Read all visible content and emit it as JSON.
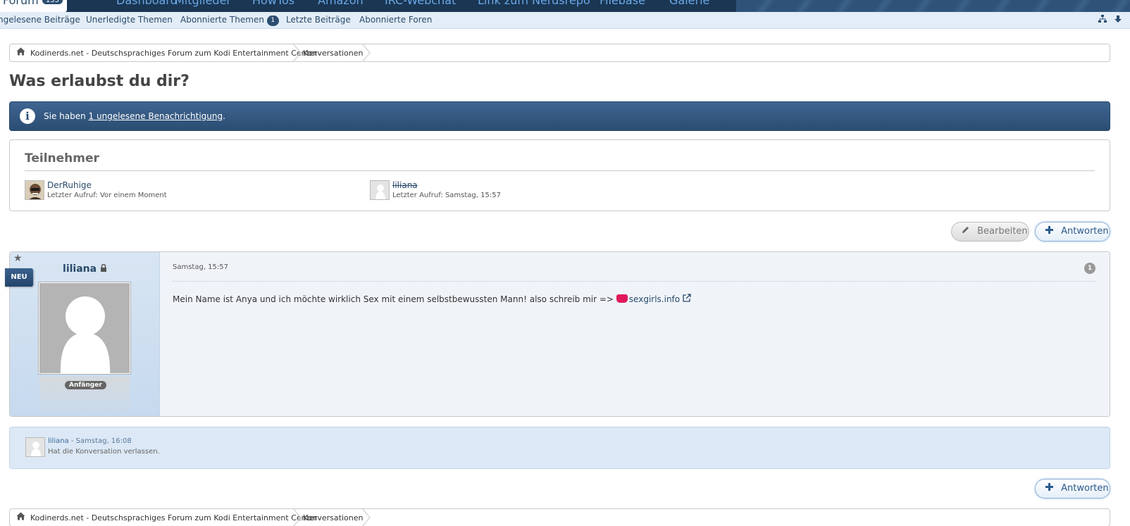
{
  "top_nav": {
    "tabs": [
      {
        "label": "Forum",
        "badge": "153"
      },
      {
        "label": "Dashboard"
      },
      {
        "label": "Mitglieder"
      },
      {
        "label": "HowTos"
      },
      {
        "label": "Amazon"
      },
      {
        "label": "IRC-Webchat"
      },
      {
        "label": "Link zum Nerdsrepo"
      },
      {
        "label": "Filebase"
      },
      {
        "label": "Galerie"
      }
    ]
  },
  "sub_nav": {
    "items": [
      {
        "label": "ngelesene Beiträge"
      },
      {
        "label": "Unerledigte Themen"
      },
      {
        "label": "Abonnierte Themen",
        "count": "1"
      },
      {
        "label": "Letzte Beiträge"
      },
      {
        "label": "Abonnierte Foren"
      }
    ],
    "icons": [
      "sitemap-icon",
      "arrow-down-icon"
    ]
  },
  "breadcrumb": {
    "items": [
      {
        "label": "Kodinerds.net - Deutschsprachiges Forum zum Kodi Entertainment Center"
      },
      {
        "label": "Konversationen"
      }
    ]
  },
  "page": {
    "title": "Was erlaubst du dir?"
  },
  "info_bar": {
    "prefix": "Sie haben",
    "link": "1 ungelesene Benachrichtigung",
    "suffix": "."
  },
  "participants": {
    "heading": "Teilnehmer",
    "items": [
      {
        "name": "DerRuhige",
        "last_seen": "Letzter Aufruf: Vor einem Moment",
        "struck": false
      },
      {
        "name": "liliana",
        "last_seen": "Letzter Aufruf: Samstag, 15:57",
        "struck": true
      }
    ]
  },
  "buttons": {
    "edit": "Bearbeiten",
    "reply": "Antworten"
  },
  "message": {
    "new_badge": "NEU",
    "author": "liliana",
    "rank": "Anfänger",
    "date": "Samstag, 15:57",
    "number": "1",
    "text": "Mein Name ist Anya und ich möchte wirklich Sex mit einem selbstbewussten Mann! also schreib mir =>",
    "link": "sexgirls.info"
  },
  "notice": {
    "user": "liliana",
    "time": " - Samstag, 16:08",
    "text": "Hat die Konversation verlassen."
  },
  "colors": {
    "nav": "#1a3652",
    "accent": "#2b4d70",
    "link": "#2a4a6b"
  }
}
